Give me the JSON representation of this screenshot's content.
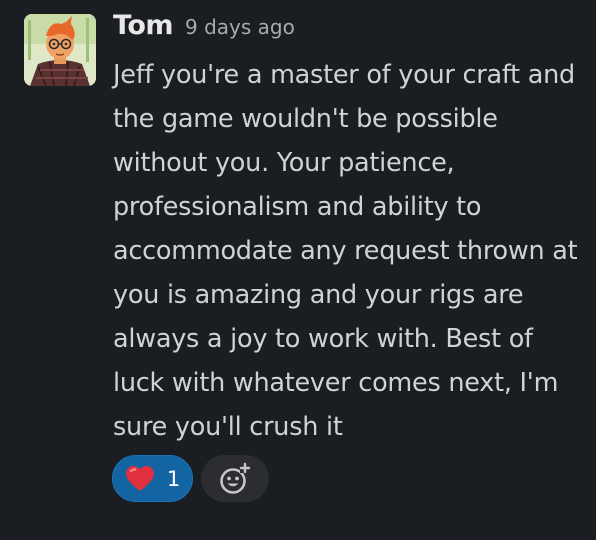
{
  "message": {
    "author": "Tom",
    "timestamp": "9 days ago",
    "avatar_icon": "cartoon-avatar",
    "text": "Jeff you're a master of your craft and\nthe game wouldn't be possible\nwithout you. Your patience,\nprofessionalism and ability to\naccommodate any request thrown at\nyou is amazing and your rigs are\nalways a joy to work with. Best of\nluck with whatever comes next, I'm\nsure you'll crush it"
  },
  "reactions": [
    {
      "emoji_icon": "heart-icon",
      "count": "1",
      "selected": true
    }
  ],
  "add_reaction_icon": "add-emoji-icon",
  "colors": {
    "background": "#1a1d21",
    "text": "#d1d2d3",
    "reaction_selected_bg": "#1264a3",
    "add_reaction_bg": "#2c2d30"
  }
}
